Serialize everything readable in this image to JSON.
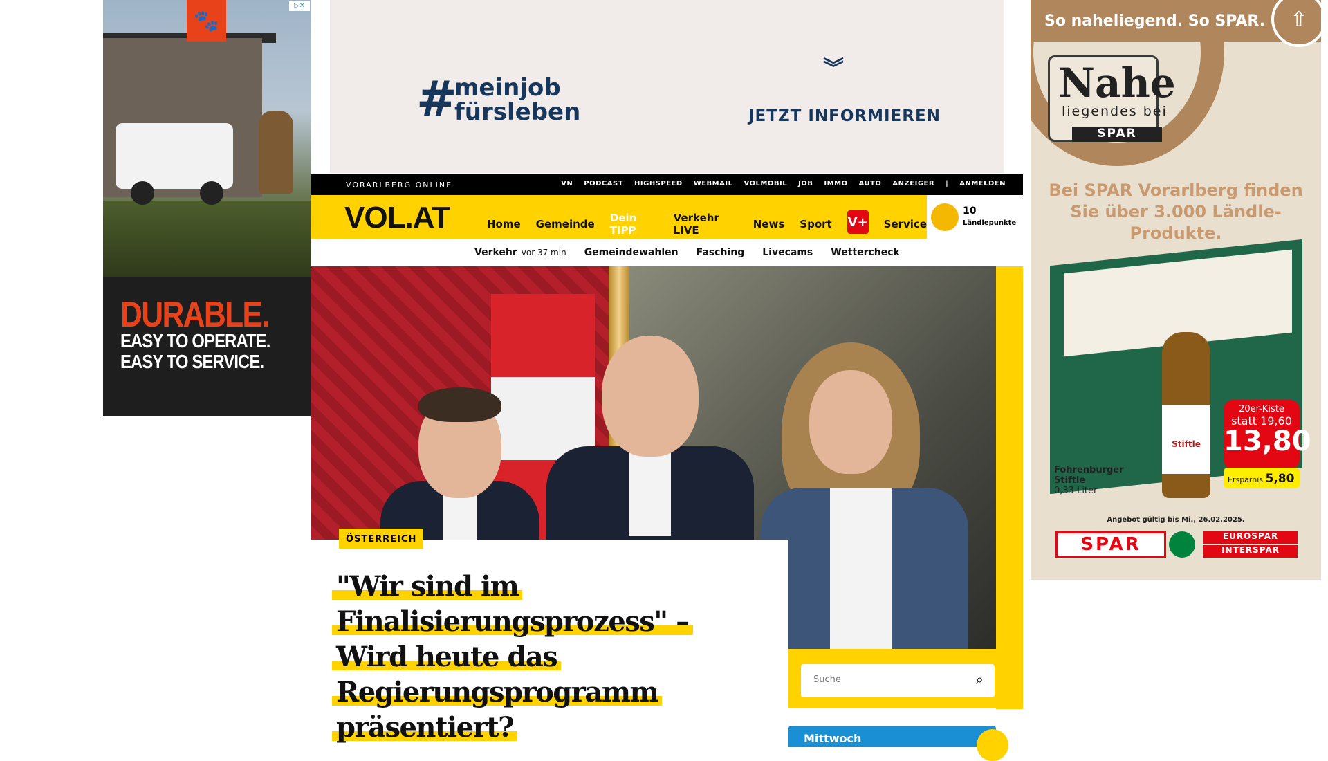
{
  "left_ad": {
    "headline": "DURABLE.",
    "line1": "EASY TO OPERATE.",
    "line2": "EASY TO SERVICE.",
    "adchoices": "▷✕"
  },
  "top_banner": {
    "hash": "#",
    "brand_line1": "meinjob",
    "brand_line2": "fürsleben",
    "cta": "JETZT INFORMIEREN"
  },
  "topbar": {
    "site": "VORARLBERG ONLINE",
    "links": [
      "VN",
      "PODCAST",
      "HIGHSPEED",
      "WEBMAIL",
      "VOLMOBIL",
      "JOB",
      "IMMO",
      "AUTO",
      "ANZEIGER",
      "|",
      "ANMELDEN"
    ]
  },
  "nav": {
    "logo": "VOL.AT",
    "items": [
      "Home",
      "Gemeinde",
      "Dein TIPP",
      "Verkehr LIVE",
      "News",
      "Sport"
    ],
    "vplus": "V+",
    "service": "Service"
  },
  "points": {
    "count": "10",
    "label": "Ländlepunkte"
  },
  "subnav": {
    "verkehr": "Verkehr",
    "verkehr_time": "vor 37 min",
    "items": [
      "Gemeindewahlen",
      "Fasching",
      "Livecams",
      "Wettercheck"
    ]
  },
  "article": {
    "tag": "ÖSTERREICH",
    "headline": "\"Wir sind im Finalisierungsprozess\" – Wird heute das Regierungsprogramm präsentiert?"
  },
  "search": {
    "placeholder": "Suche"
  },
  "weather": {
    "day": "Mittwoch"
  },
  "right_ad": {
    "slogan": "So naheliegend. So SPAR.",
    "nahe": "Nahe",
    "nahe_sub": "liegendes bei",
    "spar_mini": "SPAR",
    "promo": "Bei SPAR Vorarlberg finden Sie über 3.000 Ländle-Produkte.",
    "bottle_label": "Stiftle",
    "price_line1": "20er-Kiste",
    "price_line2": "statt 19,60",
    "price": "13,80",
    "savings_label": "Ersparnis",
    "savings": "5,80",
    "product_name": "Fohrenburger Stiftle",
    "product_qty": "0,33 Liter",
    "valid": "Angebot gültig bis Mi., 26.02.2025.",
    "spar_big": "SPAR",
    "eurospar": "EUROSPAR",
    "interspar": "INTERSPAR"
  }
}
